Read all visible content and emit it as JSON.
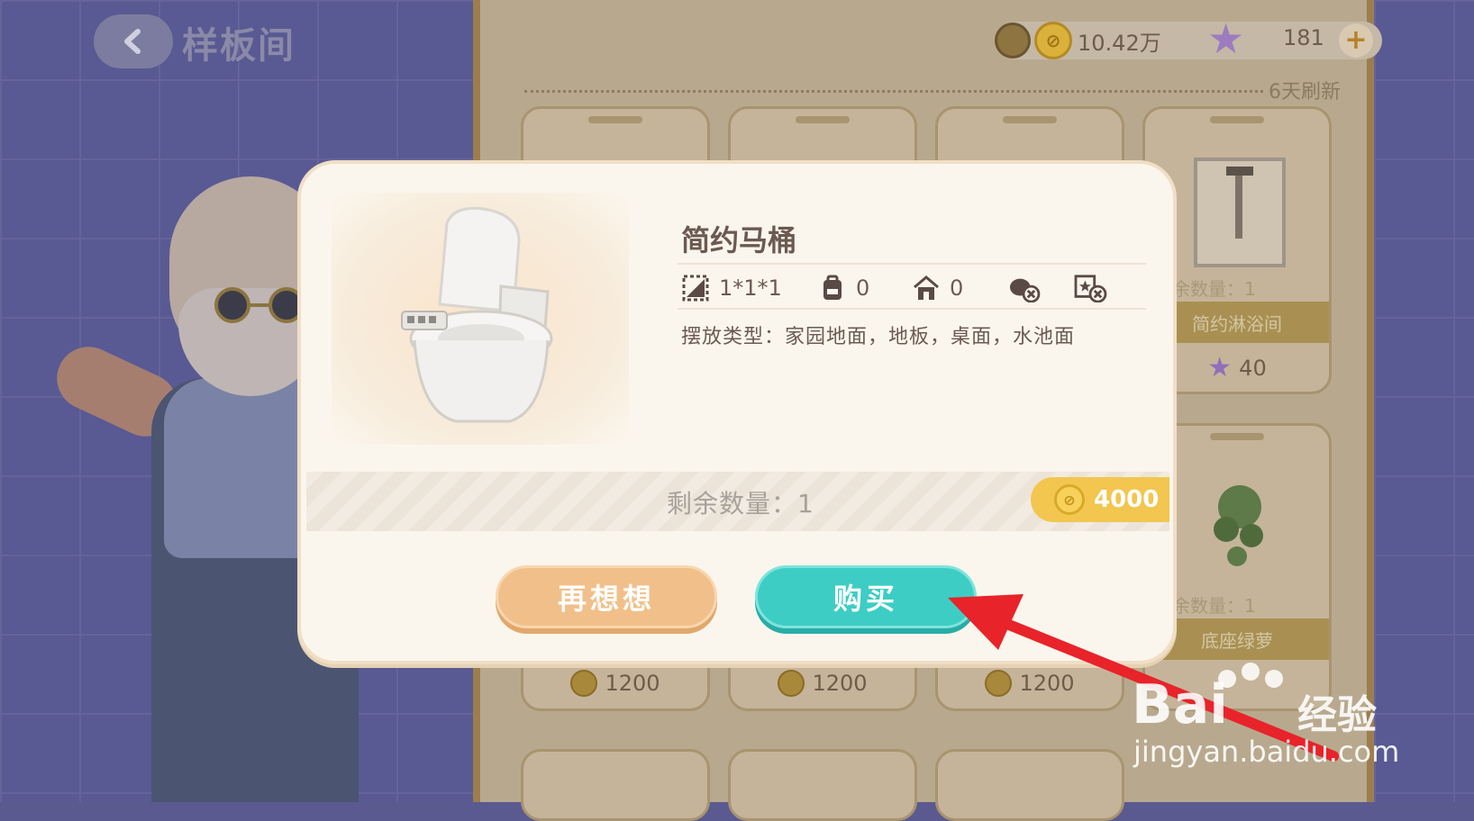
{
  "header": {
    "title": "样板间",
    "coins": "10.42万",
    "stars": "181",
    "refresh_note": "6天刷新"
  },
  "shop": {
    "cards": [
      {
        "price": "1200"
      },
      {
        "price": "1200"
      },
      {
        "price": "1200"
      },
      {
        "name": "简约淋浴间",
        "remaining": "余数量：1",
        "price": "40"
      },
      {
        "name": "底座绿萝",
        "remaining": "余数量：1"
      }
    ]
  },
  "dialog": {
    "item_name": "简约马桶",
    "size": "1*1*1",
    "backpack_count": "0",
    "house_count": "0",
    "place_type": "摆放类型：家园地面，地板，桌面，水池面",
    "remaining": "剩余数量：1",
    "price": "4000",
    "cancel_label": "再想想",
    "buy_label": "购买"
  },
  "watermark": {
    "brand": "Bai",
    "brand_cn": "经验",
    "url": "jingyan.baidu.com"
  },
  "colors": {
    "buy_button": "#3ecdc4",
    "cancel_button": "#f1c08a",
    "price_tag": "#f2c64f",
    "arrow": "#e8232a"
  },
  "icons": [
    "back-arrow-icon",
    "coin-icon",
    "star-icon",
    "plus-icon",
    "size-icon",
    "backpack-icon",
    "house-icon",
    "no-sell-icon",
    "no-favorite-icon",
    "toilet-image"
  ]
}
